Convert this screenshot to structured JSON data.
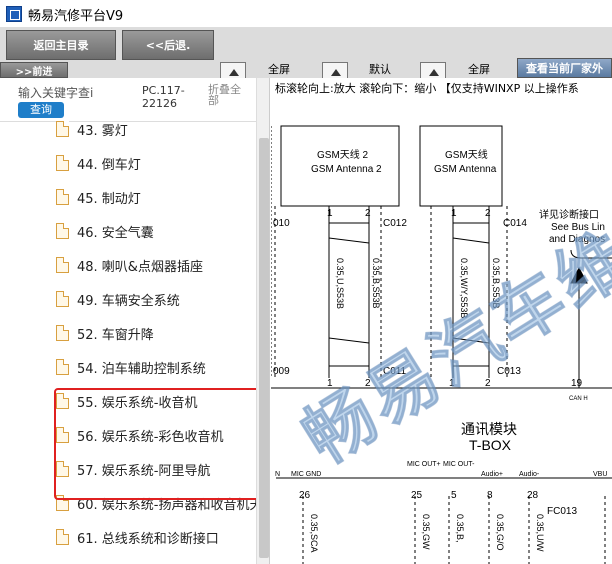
{
  "window": {
    "title": "畅易汽修平台V9"
  },
  "toolbar": {
    "back_main": "返回主目录",
    "back": "<<后退.",
    "forward": ">>前进",
    "zoom_full_1": "全屏",
    "zoom_default": "默认",
    "zoom_full_2": "全屏",
    "view_car_button": "查看当前厂家外"
  },
  "sidebar": {
    "keyword_label": "输入关键字查i",
    "query_button": "查询",
    "code": "PC.117-22126",
    "fold_all": "折叠全部",
    "items": [
      {
        "label": "43. 雾灯"
      },
      {
        "label": "44. 倒车灯"
      },
      {
        "label": "45. 制动灯"
      },
      {
        "label": "46. 安全气囊"
      },
      {
        "label": "48. 喇叭&点烟器插座"
      },
      {
        "label": "49. 车辆安全系统"
      },
      {
        "label": "52. 车窗升降"
      },
      {
        "label": "54. 泊车辅助控制系统"
      },
      {
        "label": "55. 娱乐系统-收音机"
      },
      {
        "label": "56. 娱乐系统-彩色收音机"
      },
      {
        "label": "57. 娱乐系统-阿里导航"
      },
      {
        "label": "60. 娱乐系统-扬声器和收音机天"
      },
      {
        "label": "61. 总线系统和诊断接口"
      }
    ]
  },
  "diagram": {
    "hint": "标滚轮向上:放大  滚轮向下：缩小 【仅支持WINXP 以上操作系",
    "watermark": "畅易汽车维修",
    "gsm2_cn": "GSM天线 2",
    "gsm2_en": "GSM Antenna 2",
    "gsm_cn": "GSM天线",
    "gsm_en": "GSM Antenna",
    "c010": "010",
    "c012": "C012",
    "c014": "C014",
    "c011": "C011",
    "c013": "C013",
    "c009": "009",
    "pin1a": "1",
    "pin2a": "2",
    "pin1b": "1",
    "pin2b": "2",
    "pin1c": "1",
    "pin2c": "2",
    "pin1d": "1",
    "pin2d": "2",
    "wire1": "0.35,U,S53B",
    "wire2": "0.35,B,S53B",
    "wire3": "0.35,W/Y,S53B",
    "wire4": "0.35,B,S53B",
    "diag_cn": "详见诊断接口",
    "diag_en1": "See Bus Lin",
    "diag_en2": "and Diagnos",
    "pin19": "19",
    "can_h": "CAN H",
    "tbox_cn": "通讯模块",
    "tbox_en": "T-BOX",
    "lbl_n": "N",
    "mic_gnd": "MIC GND",
    "mic_out_p": "MIC OUT+",
    "mic_out_m": "MIC OUT-",
    "audio_p": "Audio+",
    "audio_m": "Audio-",
    "vbu": "VBU",
    "p26": "26",
    "p25": "25",
    "p5": "5",
    "p8": "8",
    "p28": "28",
    "fc013": "FC013",
    "w_sca": "0.35,SCA",
    "w_gw": "0.35,GW",
    "w_b": "0.35,B,",
    "w_glo": "0.35,G/O",
    "w_uw": "0.35,U/W"
  }
}
